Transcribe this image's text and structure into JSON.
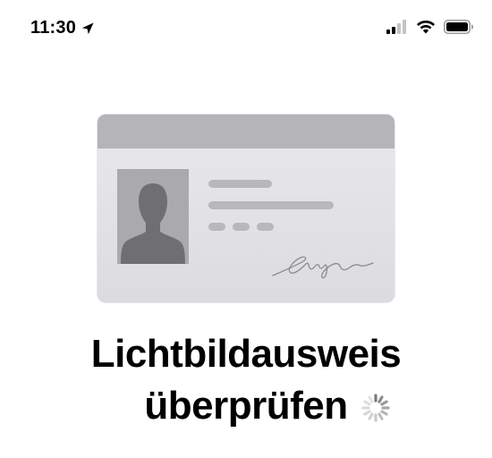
{
  "status_bar": {
    "time": "11:30",
    "icons": [
      "location-arrow-icon",
      "cellular-signal-icon",
      "wifi-icon",
      "battery-icon"
    ]
  },
  "illustration": {
    "type": "id-card",
    "icons": [
      "id-card-icon",
      "person-silhouette-icon",
      "signature-icon"
    ],
    "colors": {
      "card": "#e4e4e7",
      "band": "#b4b4b9",
      "photo_background": "#a9a9ae",
      "silhouette": "#6e6e73",
      "lines": "#b7b7bc"
    }
  },
  "title": {
    "line1": "Lichtbildausweis",
    "line2": "überprüfen"
  },
  "loading_indicator": {
    "icon": "spinner-icon",
    "state": "loading"
  }
}
